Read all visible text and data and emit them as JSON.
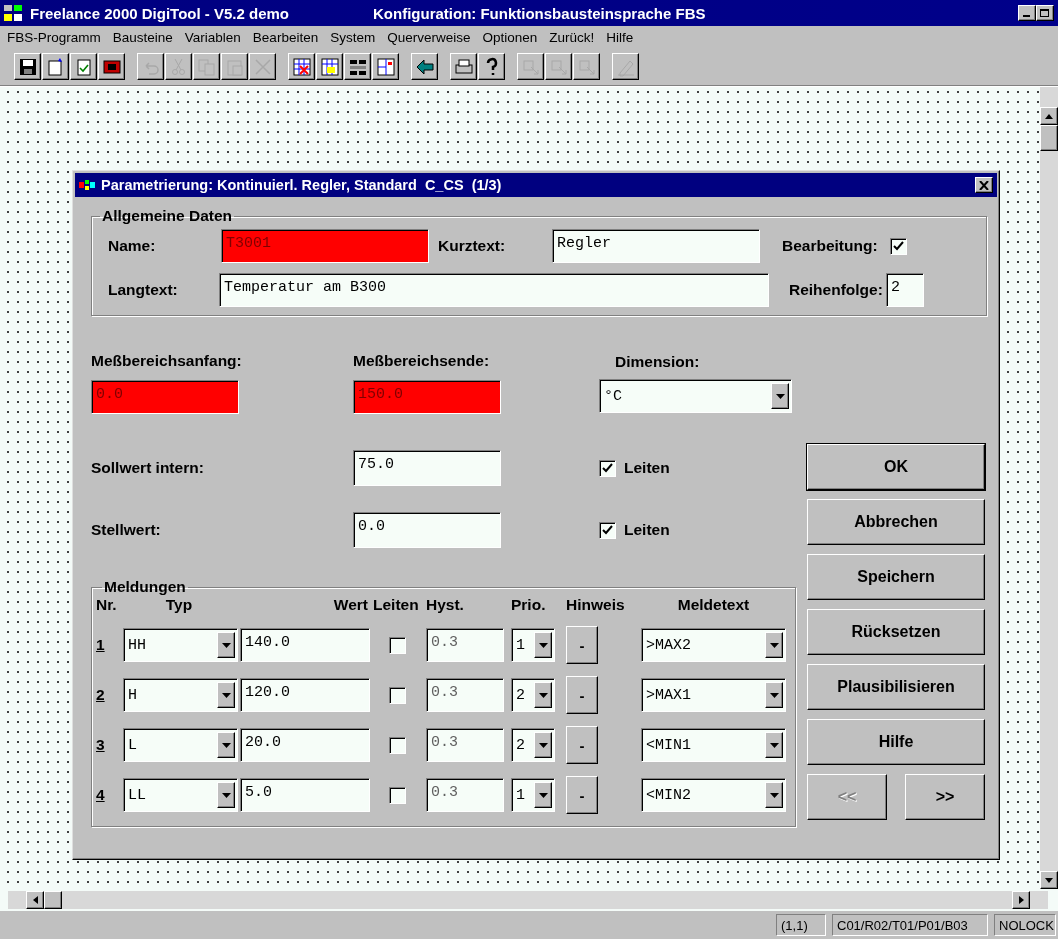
{
  "window": {
    "title": "Freelance 2000 DigiTool - V5.2 demo",
    "subtitle": "Konfiguration: Funktionsbausteinsprache FBS"
  },
  "menu": [
    "FBS-Programm",
    "Bausteine",
    "Variablen",
    "Bearbeiten",
    "System",
    "Querverweise",
    "Optionen",
    "Zurück!",
    "Hilfe"
  ],
  "toolbar": [
    [
      {
        "kind": "save",
        "disabled": false
      },
      {
        "kind": "new",
        "disabled": false
      },
      {
        "kind": "check",
        "disabled": false
      },
      {
        "kind": "block",
        "disabled": false
      }
    ],
    [
      {
        "kind": "undo",
        "disabled": true
      },
      {
        "kind": "cut",
        "disabled": true
      },
      {
        "kind": "copy",
        "disabled": true
      },
      {
        "kind": "paste",
        "disabled": true
      },
      {
        "kind": "delete",
        "disabled": true
      }
    ],
    [
      {
        "kind": "grid",
        "disabled": false
      },
      {
        "kind": "gridwarn",
        "disabled": false
      },
      {
        "kind": "bars",
        "disabled": false
      },
      {
        "kind": "panels",
        "disabled": false
      }
    ],
    [
      {
        "kind": "back",
        "disabled": false
      }
    ],
    [
      {
        "kind": "print",
        "disabled": false
      },
      {
        "kind": "help",
        "disabled": false
      }
    ],
    [
      {
        "kind": "tool",
        "disabled": true
      },
      {
        "kind": "tool",
        "disabled": true
      },
      {
        "kind": "tool",
        "disabled": true
      }
    ],
    [
      {
        "kind": "pen",
        "disabled": true
      }
    ]
  ],
  "dialog": {
    "title": "Parametrierung: Kontinuierl. Regler, Standard  C_CS  (1/3)",
    "general": {
      "legend": "Allgemeine Daten",
      "name_label": "Name:",
      "name": "T3001",
      "name_error": true,
      "short_label": "Kurztext:",
      "short": "Regler",
      "edit_label": "Bearbeitung:",
      "edit_checked": true,
      "long_label": "Langtext:",
      "long": "Temperatur am B300",
      "order_label": "Reihenfolge:",
      "order": "2"
    },
    "range": [
      {
        "label": "Meßbereichsanfang:",
        "value": "0.0",
        "error": true
      },
      {
        "label": "Meßbereichsende:",
        "value": "150.0",
        "error": true
      }
    ],
    "dimension": {
      "label": "Dimension:",
      "value": "°C"
    },
    "values": [
      {
        "label": "Sollwert intern:",
        "value": "75.0",
        "checkbox_label": "Leiten",
        "checked": true
      },
      {
        "label": "Stellwert:",
        "value": "0.0",
        "checkbox_label": "Leiten",
        "checked": true
      }
    ],
    "messages": {
      "legend": "Meldungen",
      "columns": [
        "Nr.",
        "Typ",
        "Wert",
        "Leiten",
        "Hyst.",
        "Prio.",
        "Hinweis",
        "Meldetext"
      ],
      "rows": [
        {
          "nr": "1",
          "type": "HH",
          "value": "140.0",
          "checked": false,
          "hyst": "0.3",
          "prio": "1",
          "hint": "-",
          "text": ">MAX2"
        },
        {
          "nr": "2",
          "type": "H",
          "value": "120.0",
          "checked": false,
          "hyst": "0.3",
          "prio": "2",
          "hint": "-",
          "text": ">MAX1"
        },
        {
          "nr": "3",
          "type": "L",
          "value": "20.0",
          "checked": false,
          "hyst": "0.3",
          "prio": "2",
          "hint": "-",
          "text": "<MIN1"
        },
        {
          "nr": "4",
          "type": "LL",
          "value": "5.0",
          "checked": false,
          "hyst": "0.3",
          "prio": "1",
          "hint": "-",
          "text": "<MIN2"
        }
      ]
    },
    "buttons": [
      {
        "label": "OK",
        "default": true
      },
      {
        "label": "Abbrechen",
        "default": false
      },
      {
        "label": "Speichern",
        "default": false
      },
      {
        "label": "Rücksetzen",
        "default": false
      },
      {
        "label": "Plausibilisieren",
        "default": false
      },
      {
        "label": "Hilfe",
        "default": false
      }
    ],
    "nav": [
      {
        "label": "<<",
        "disabled": true
      },
      {
        "label": ">>",
        "disabled": false
      }
    ]
  },
  "status_bar": [
    "(1,1)",
    "C01/R02/T01/P01/B03",
    "NOLOCK"
  ]
}
